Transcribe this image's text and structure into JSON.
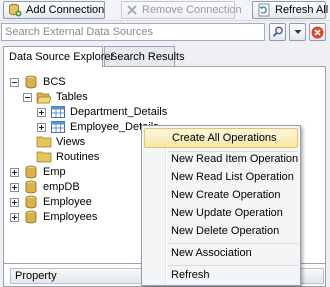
{
  "toolbar": {
    "add_connection": "Add Connection",
    "remove_connection": "Remove Connection",
    "refresh_all": "Refresh All"
  },
  "search": {
    "placeholder": "Search External Data Sources",
    "value": ""
  },
  "tabs": [
    {
      "label": "Data Source Explorer",
      "active": true
    },
    {
      "label": "Search Results",
      "active": false
    }
  ],
  "tree": {
    "root": "BCS",
    "tables": "Tables",
    "department_details": "Department_Details",
    "employee_details": "Employee_Details",
    "views": "Views",
    "routines": "Routines",
    "emp": "Emp",
    "empdb": "empDB",
    "employee": "Employee",
    "employees": "Employees"
  },
  "property_header": "Property",
  "context_menu": {
    "create_all_operations": "Create All Operations",
    "new_read_item_operation": "New Read Item Operation",
    "new_read_list_operation": "New Read List Operation",
    "new_create_operation": "New Create Operation",
    "new_update_operation": "New Update Operation",
    "new_delete_operation": "New Delete Operation",
    "new_association": "New Association",
    "refresh": "Refresh"
  },
  "colors": {
    "highlight": "#f7e4a4",
    "folder": "#e8c25a",
    "database": "#d9b24a",
    "delete_red": "#d9472b"
  }
}
